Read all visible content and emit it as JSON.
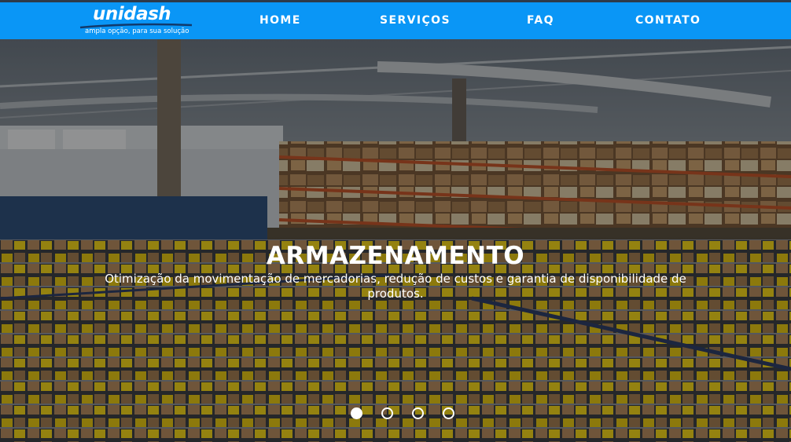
{
  "brand": {
    "name": "unidash",
    "tagline": "ampla opção, para sua solução",
    "color": "#0a96f6"
  },
  "nav": {
    "items": [
      {
        "label": "HOME"
      },
      {
        "label": "SERVIÇOS"
      },
      {
        "label": "FAQ"
      },
      {
        "label": "CONTATO"
      }
    ]
  },
  "hero": {
    "title": "ARMAZENAMENTO",
    "text": "Otimização da movimentação de mercadorias, redução de custos e garantia de disponibilidade de produtos.",
    "background": "warehouse-photo",
    "slides": {
      "count": 4,
      "active": 1
    }
  }
}
